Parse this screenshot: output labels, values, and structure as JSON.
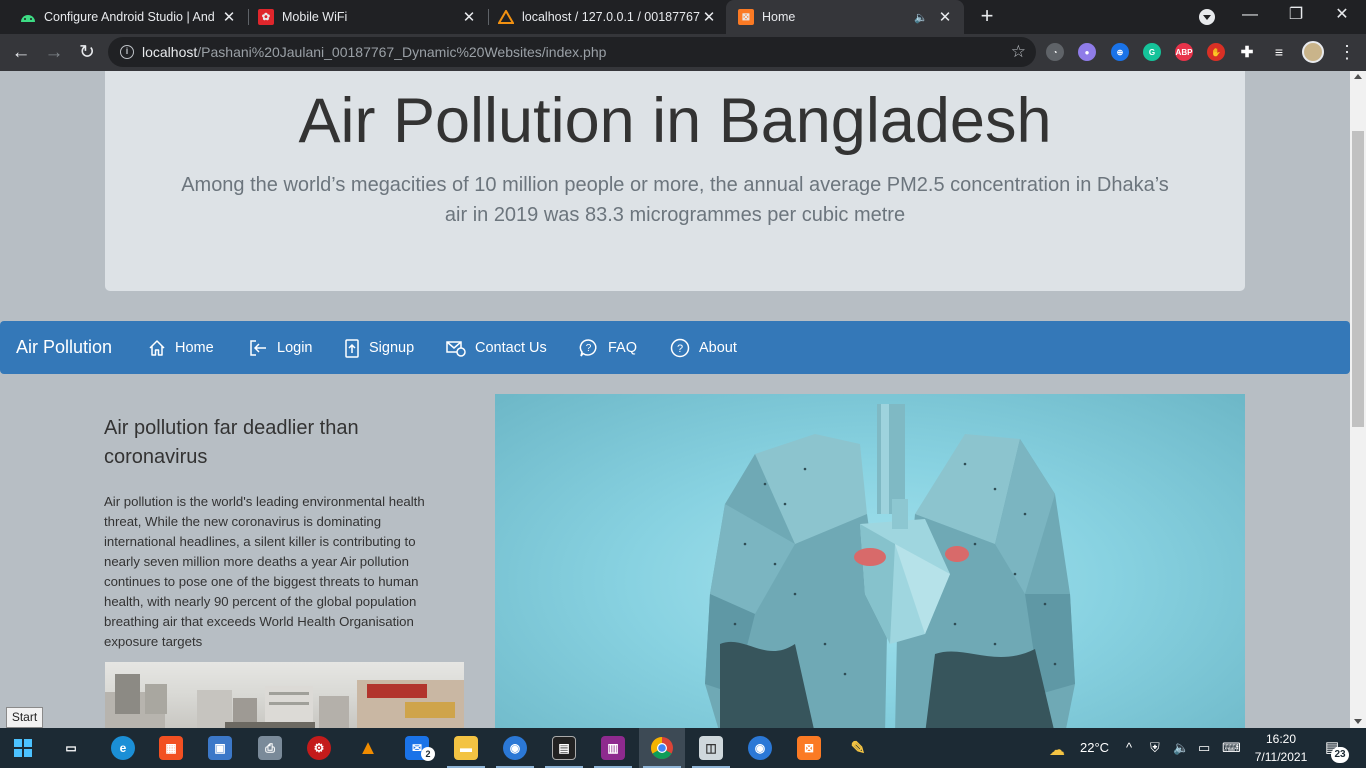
{
  "browser": {
    "tabs": [
      {
        "title": "Configure Android Studio  |  And",
        "icon": "android-icon",
        "color": "#3ddc84"
      },
      {
        "title": "Mobile WiFi",
        "icon": "huawei-icon",
        "color": "#e0262c"
      },
      {
        "title": "localhost / 127.0.0.1 / 00187767",
        "icon": "phpmyadmin-icon",
        "color": "#f29111"
      },
      {
        "title": "Home",
        "icon": "xampp-icon",
        "color": "#fb7a24"
      }
    ],
    "url_host": "localhost",
    "url_path": "/Pashani%20Jaulani_00187767_Dynamic%20Websites/index.php"
  },
  "page": {
    "title": "Air Pollution in Bangladesh",
    "lead": "Among the world’s megacities of 10 million people or more, the annual average PM2.5 concentration in Dhaka’s air in 2019 was 83.3 microgrammes per cubic metre",
    "navbar": {
      "brand": "Air Pollution",
      "links": [
        {
          "label": "Home",
          "icon": "home-icon"
        },
        {
          "label": "Login",
          "icon": "login-icon"
        },
        {
          "label": "Signup",
          "icon": "signup-icon"
        },
        {
          "label": "Contact Us",
          "icon": "contact-icon"
        },
        {
          "label": "FAQ",
          "icon": "faq-icon"
        },
        {
          "label": "About",
          "icon": "about-icon"
        }
      ],
      "color": "#3478b8"
    },
    "article": {
      "title": "Air pollution far deadlier than coronavirus",
      "body": "Air pollution is the world's leading environmental health threat, While the new coronavirus is dominating international headlines, a silent killer is contributing to nearly seven million more deaths a year Air pollution continues to pose one of the biggest threats to human health, with nearly 90 percent of the global population breathing air that exceeds World Health Organisation exposure targets"
    }
  },
  "taskbar": {
    "start_tooltip": "Start",
    "weather_temp": "22°C",
    "time": "16:20",
    "date": "7/11/2021",
    "notifications": "23",
    "mail_badge": "2"
  }
}
